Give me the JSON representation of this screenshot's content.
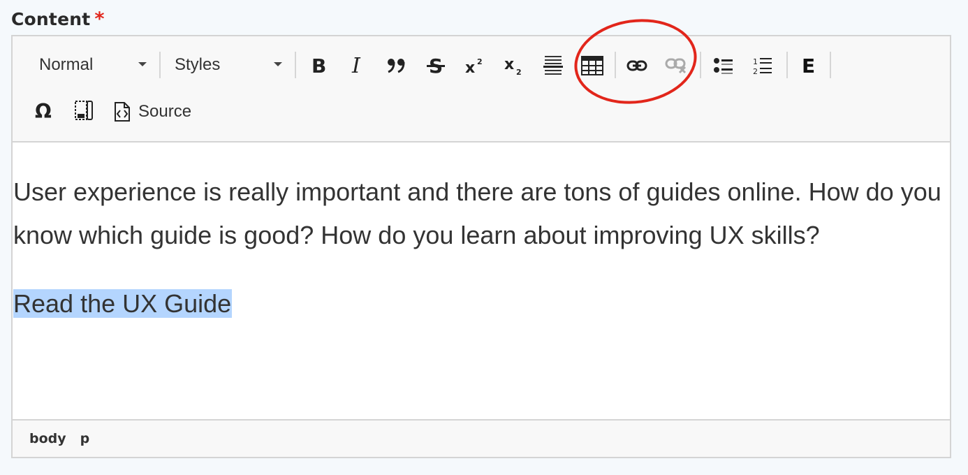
{
  "field": {
    "label": "Content",
    "required_mark": "*"
  },
  "toolbar": {
    "format_select": "Normal",
    "styles_select": "Styles",
    "source_label": "Source",
    "buttons": [
      "bold-icon",
      "italic-icon",
      "blockquote-icon",
      "strikethrough-icon",
      "superscript-icon",
      "subscript-icon",
      "horizontal-line-icon",
      "table-icon",
      "link-icon",
      "unlink-icon",
      "bulleted-list-icon",
      "numbered-list-icon",
      "embed-icon",
      "special-character-icon",
      "insert-template-icon",
      "source-icon"
    ]
  },
  "content": {
    "paragraph": "User experience is really important and there are tons of guides online. How do you know which guide is good? How do you learn about improving UX skills?",
    "selected_text": "Read the UX Guide"
  },
  "pathbar": {
    "items": [
      "body",
      "p"
    ]
  },
  "colors": {
    "selection": "#b4d5fe",
    "annotation_ring": "#e2261b",
    "required": "#e1261c"
  }
}
